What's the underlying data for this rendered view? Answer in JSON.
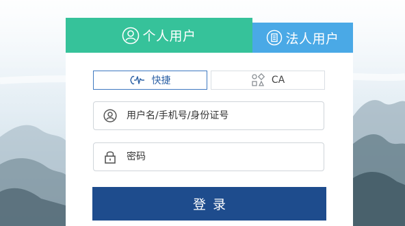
{
  "tabs": {
    "personal": {
      "label": "个人用户",
      "icon": "user-circle-icon"
    },
    "legal": {
      "label": "法人用户",
      "icon": "building-doc-icon"
    }
  },
  "login_modes": {
    "quick": {
      "label": "快捷",
      "icon": "pulse-icon"
    },
    "ca": {
      "label": "CA",
      "icon": "ca-cert-icon"
    }
  },
  "fields": {
    "username": {
      "placeholder": "用户名/手机号/身份证号",
      "value": "",
      "icon": "user-icon"
    },
    "password": {
      "placeholder": "密码",
      "value": "",
      "icon": "lock-icon"
    }
  },
  "login_button": {
    "label": "登录"
  },
  "colors": {
    "personal_tab": "#36c29a",
    "legal_tab": "#4aa9e6",
    "login_button": "#1e4c8d",
    "active_mode_border": "#3d78c0"
  }
}
